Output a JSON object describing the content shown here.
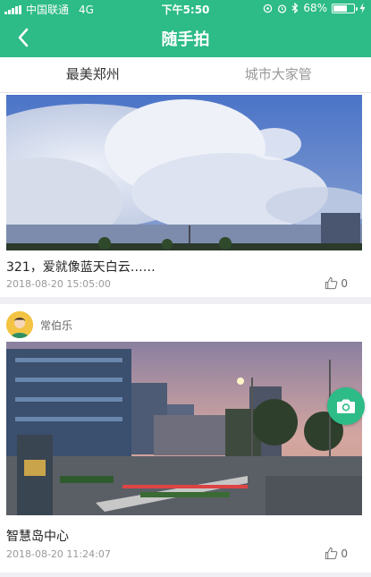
{
  "status_bar": {
    "carrier": "中国联通",
    "network": "4G",
    "time": "下午5:50",
    "battery": "68%",
    "battery_level": 0.68
  },
  "nav": {
    "title": "随手拍"
  },
  "tabs": [
    {
      "label": "最美郑州",
      "active": true
    },
    {
      "label": "城市大家管",
      "active": false
    }
  ],
  "posts": [
    {
      "caption": "321，爱就像蓝天白云……",
      "time": "2018-08-20 15:05:00",
      "likes": "0"
    },
    {
      "author": "常伯乐",
      "caption": "智慧岛中心",
      "time": "2018-08-20 11:24:07",
      "likes": "0"
    }
  ],
  "colors": {
    "brand": "#2dbb87"
  },
  "icons": {
    "back": "chevron-left-icon",
    "like": "thumbs-up-icon",
    "camera": "camera-icon"
  }
}
